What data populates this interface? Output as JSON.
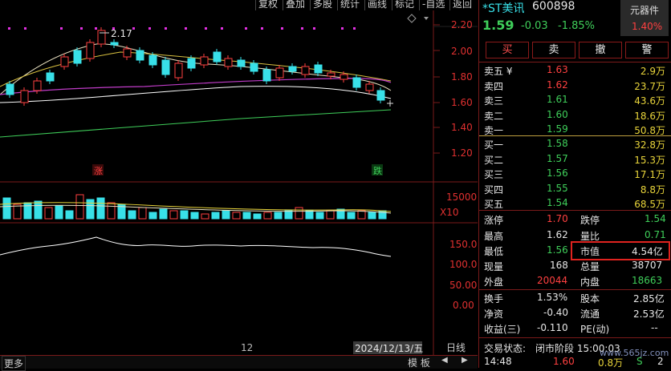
{
  "toolbar": {
    "buttons": [
      "复权",
      "叠加",
      "多股",
      "统计",
      "画线",
      "标记",
      "-自选",
      "返回"
    ]
  },
  "chart": {
    "price_axis": [
      "2.20",
      "2.00",
      "1.80",
      "1.60",
      "1.40",
      "1.20"
    ],
    "volume_axis": [
      "15000",
      "X10"
    ],
    "indicator_axis": [
      "150.00",
      "100.00",
      "50.00",
      "0.00"
    ],
    "high_label": "2.17",
    "up_marker": "涨",
    "down_marker": "跌",
    "x_tick": "12",
    "date_label": "2024/12/13/五",
    "period": "日线",
    "more": "更多",
    "template": "模 板"
  },
  "stock": {
    "name": "*ST美讯",
    "code": "600898",
    "price": "1.59",
    "change": "-0.03",
    "change_pct": "-1.85%",
    "sector": "元器件",
    "sector_pct": "1.40%"
  },
  "trade_buttons": [
    "买",
    "卖",
    "撤",
    "警"
  ],
  "order_book": {
    "asks": [
      {
        "label": "卖五 ¥",
        "price": "1.63",
        "vol": "2.9万"
      },
      {
        "label": "卖四",
        "price": "1.62",
        "vol": "23.7万"
      },
      {
        "label": "卖三",
        "price": "1.61",
        "vol": "43.6万"
      },
      {
        "label": "卖二",
        "price": "1.60",
        "vol": "18.6万"
      },
      {
        "label": "卖一",
        "price": "1.59",
        "vol": "50.8万"
      }
    ],
    "bids": [
      {
        "label": "买一",
        "price": "1.58",
        "vol": "32.8万"
      },
      {
        "label": "买二",
        "price": "1.57",
        "vol": "15.3万"
      },
      {
        "label": "买三",
        "price": "1.56",
        "vol": "17.1万"
      },
      {
        "label": "买四",
        "price": "1.55",
        "vol": "8.8万"
      },
      {
        "label": "买五",
        "price": "1.54",
        "vol": "68.5万"
      }
    ]
  },
  "stats": {
    "limit_up_label": "涨停",
    "limit_up": "1.70",
    "limit_down_label": "跌停",
    "limit_down": "1.54",
    "high_label": "最高",
    "high": "1.62",
    "vol_ratio_label": "量比",
    "vol_ratio": "0.71",
    "low_label": "最低",
    "low": "1.56",
    "mcap_label": "市值",
    "mcap": "4.54亿",
    "last_vol_label": "现量",
    "last_vol": "168",
    "total_vol_label": "总量",
    "total_vol": "38707",
    "outer_label": "外盘",
    "outer": "20044",
    "inner_label": "内盘",
    "inner": "18663",
    "turnover_label": "换手",
    "turnover": "1.53%",
    "shares_label": "股本",
    "shares": "2.85亿",
    "nav_label": "净资",
    "nav": "-0.40",
    "float_label": "流通",
    "float": "2.53亿",
    "eps_label": "收益(三)",
    "eps": "-0.110",
    "pe_label": "PE(动)",
    "pe": "--"
  },
  "status": {
    "label": "交易状态:",
    "value": "闭市阶段 15:00:03",
    "tick_time": "14:48",
    "tick_price": "1.60",
    "tick_vol": "0.8万",
    "tick_flag": "S",
    "tick_count": "2",
    "watermark": "www.565jz.com"
  },
  "colors": {
    "up": "#ff4040",
    "down": "#3fcf5a",
    "cyan": "#38e0e8",
    "border": "#7a1a1a"
  }
}
